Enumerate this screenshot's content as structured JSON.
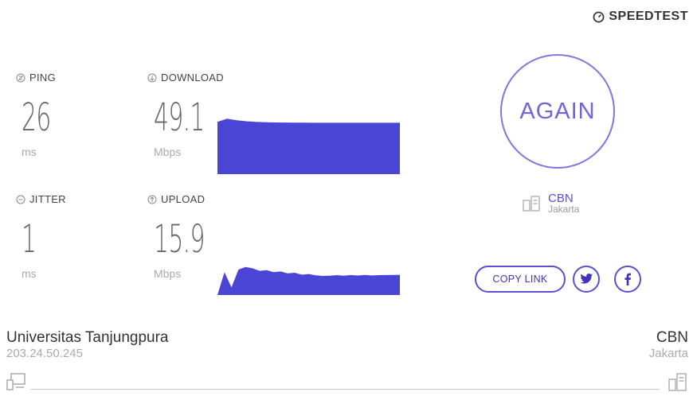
{
  "brand": {
    "name": "SPEEDTEST",
    "icon": "gauge-icon"
  },
  "metrics": {
    "ping": {
      "label": "PING",
      "value": "26",
      "unit": "ms",
      "icon": "ping-icon"
    },
    "jitter": {
      "label": "JITTER",
      "value": "1",
      "unit": "ms",
      "icon": "jitter-icon"
    },
    "download": {
      "label": "DOWNLOAD",
      "value": "49.1",
      "unit": "Mbps",
      "icon": "download-arrow-icon"
    },
    "upload": {
      "label": "UPLOAD",
      "value": "15.9",
      "unit": "Mbps",
      "icon": "upload-arrow-icon"
    }
  },
  "again_button": {
    "label": "AGAIN"
  },
  "server": {
    "name": "CBN",
    "location": "Jakarta",
    "icon": "server-icon"
  },
  "share": {
    "copy_link_label": "COPY LINK",
    "twitter_icon": "twitter-icon",
    "facebook_icon": "facebook-icon"
  },
  "client": {
    "isp": "Universitas Tanjungpura",
    "ip": "203.24.50.245",
    "icon": "computer-icon"
  },
  "host": {
    "name": "CBN",
    "location": "Jakarta",
    "icon": "server-icon"
  },
  "colors": {
    "accent": "#4b45d6",
    "accent_light": "#7f75e0",
    "label": "#444444",
    "value": "#666666",
    "muted": "#aaaaaa"
  },
  "chart_data": [
    {
      "type": "area",
      "title": "",
      "series": [
        {
          "values": [
            50,
            53,
            51.5,
            50.5,
            50,
            49.6,
            49.4,
            49.3,
            49.2,
            49.15,
            49.1,
            49.1,
            49.1,
            49.1,
            49.1,
            49.1,
            49.1,
            49.1,
            49.1,
            49.1
          ]
        }
      ],
      "ylim": [
        0,
        60
      ]
    },
    {
      "type": "area",
      "title": "",
      "series": [
        {
          "values": [
            0,
            18,
            6,
            20,
            22,
            21,
            19,
            19.5,
            18,
            18.5,
            17,
            17.5,
            16,
            16.5,
            15.5,
            15,
            15.2,
            15.6,
            15.2,
            15.7,
            15.3,
            15.8,
            15.4,
            15.6,
            15.7,
            15.8,
            15.9
          ]
        }
      ],
      "ylim": [
        0,
        50
      ]
    }
  ]
}
